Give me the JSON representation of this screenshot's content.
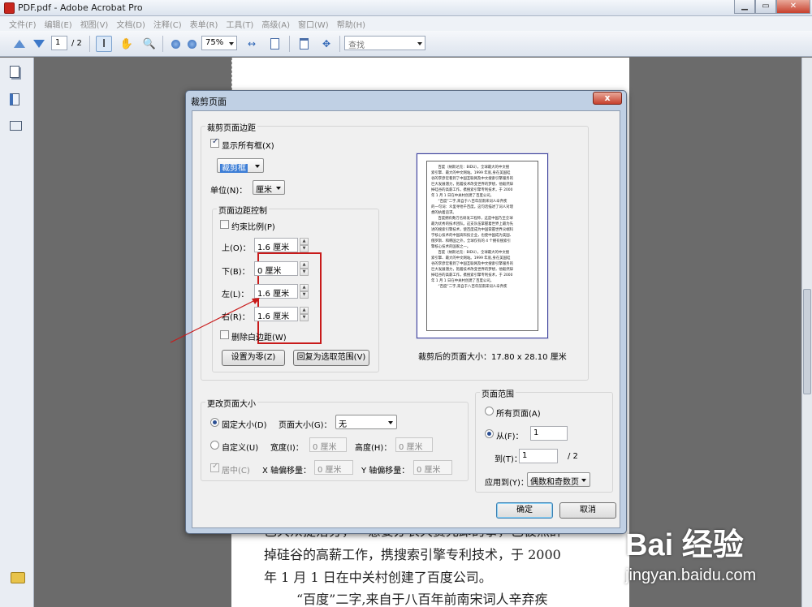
{
  "window": {
    "title": "PDF.pdf - Adobe Acrobat Pro"
  },
  "menubar": [
    "文件(F)",
    "编辑(E)",
    "视图(V)",
    "文档(D)",
    "注释(C)",
    "表单(R)",
    "工具(T)",
    "高级(A)",
    "窗口(W)",
    "帮助(H)"
  ],
  "toolbar": {
    "page_current": "1",
    "page_total": "/ 2",
    "zoom": "75%",
    "find_placeholder": "查找"
  },
  "document": {
    "lines": [
      "已大众提落分，一意要办农大赛先卸的事，已彼然辞",
      "掉硅谷的高薪工作，携搜索引擎专利技术，于 2000",
      "年 1 月 1 日在中关村创建了百度公司。",
      "“百度”二字,来自于八百年前南宋词人辛弃疾"
    ]
  },
  "dialog": {
    "title": "裁剪页面",
    "close_label": "x",
    "margins_group": "裁剪页面边距",
    "show_all_boxes": "显示所有框(X)",
    "box_select": "裁剪框",
    "unit_label": "单位(N)：",
    "unit_value": "厘米",
    "margin_control_group": "页面边距控制",
    "constrain": "约束比例(P)",
    "top_label": "上(O)：",
    "top_value": "1.6 厘米",
    "bottom_label": "下(B)：",
    "bottom_value": "0 厘米",
    "left_label": "左(L)：",
    "left_value": "1.6 厘米",
    "right_label": "右(R)：",
    "right_value": "1.6 厘米",
    "remove_white": "删除白边距(W)",
    "set_zero": "设置为零(Z)",
    "revert": "回复为选取范围(V)",
    "preview_caption": "裁剪后的页面大小：17.80 x 28.10 厘米",
    "preview_text": "      百度（纳斯达克：BIDU），全球最大的中文搜\n索引擎、最大的中文网站。1999 年底,身在美国硅\n谷的李彦宏看到了中国互联网及中文搜索引擎服务的\n巨大发展潜力，抱着技术改变世界的梦想，他毅然辞\n掉硅谷的高薪工作，携搜索引擎专利技术，于 2000\n年 1 月 1 日在中关村创建了百度公司。\n      “百度”二字,来自于八百年前南宋词人辛弃疾\n的一句词：众里寻他千百度。这句话描述了词人对理\n想的执着追求。\n      百度拥有数万名研发工程师，这是中国乃至全球\n最为优秀的技术团队。这支队伍掌握着世界上最为先\n进的搜索引擎技术，使百度成为中国掌握世界尖端科\n学核心技术的中国高科技企业，也使中国成为美国、\n俄罗斯、和韩国之外，全球仅有的 4 个拥有搜索引\n擎核心技术的国家之一。\n      百度（纳斯达克：BIDU），全球最大的中文搜\n索引擎、最大的中文网站。1999 年底,身在美国硅\n谷的李彦宏看到了中国互联网及中文搜索引擎服务的\n巨大发展潜力，抱着技术改变世界的梦想，他毅然辞\n掉硅谷的高薪工作，携搜索引擎专利技术，于 2000\n年 1 月 1 日在中关村创建了百度公司。\n      “百度”二字,来自于八百年前南宋词人辛弃疾",
    "resize_group": "更改页面大小",
    "fixed_size": "固定大小(D)",
    "page_size_label": "页面大小(G)：",
    "page_size_value": "无",
    "custom": "自定义(U)",
    "width_label": "宽度(I)：",
    "width_value": "0 厘米",
    "height_label": "高度(H)：",
    "height_value": "0 厘米",
    "center": "居中(C)",
    "x_offset_label": "X 轴偏移量：",
    "x_offset_value": "0 厘米",
    "y_offset_label": "Y 轴偏移量：",
    "y_offset_value": "0 厘米",
    "range_group": "页面范围",
    "all_pages": "所有页面(A)",
    "from_label": "从(F)：",
    "from_value": "1",
    "to_label": "到(T)：",
    "to_value": "1",
    "to_total": "/ 2",
    "apply_label": "应用到(Y)：",
    "apply_value": "偶数和奇数页",
    "ok": "确定",
    "cancel": "取消"
  },
  "watermark": {
    "logo": "Bai 经验",
    "url": "jingyan.baidu.com"
  },
  "colors": {
    "highlight": "#c81a1a",
    "accent": "#3d7ed6"
  }
}
